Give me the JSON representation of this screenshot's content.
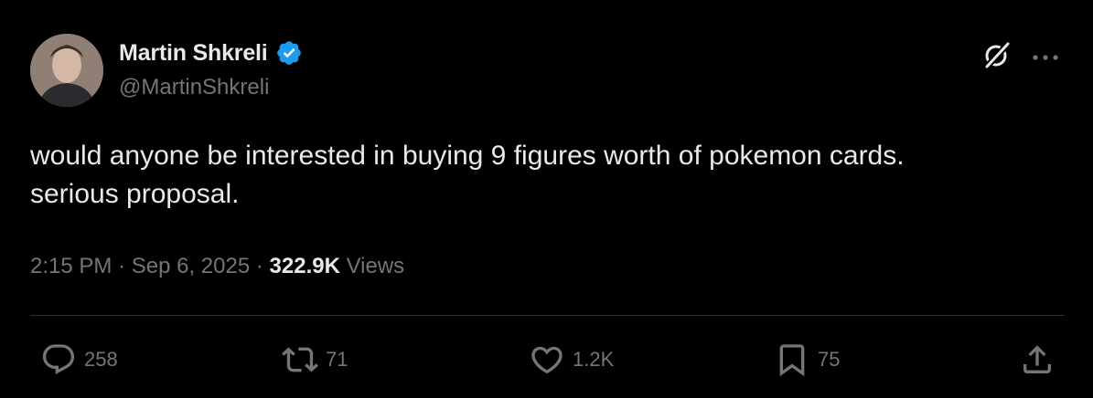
{
  "author": {
    "display_name": "Martin Shkreli",
    "handle": "@MartinShkreli",
    "verified": true
  },
  "tweet": {
    "text_lines": [
      "would anyone be interested in buying 9 figures worth of pokemon cards.",
      "serious proposal."
    ],
    "time": "2:15 PM",
    "date": "Sep 6, 2025",
    "separator": "·",
    "views_count": "322.9K",
    "views_label": "Views"
  },
  "actions": {
    "replies": "258",
    "reposts": "71",
    "likes": "1.2K",
    "bookmarks": "75"
  },
  "icons": [
    "grok-icon",
    "more-icon",
    "verified-badge-icon",
    "reply-icon",
    "repost-icon",
    "like-icon",
    "bookmark-icon",
    "share-icon"
  ],
  "colors": {
    "background": "#000000",
    "primary_text": "#e7e9ea",
    "secondary_text": "#71767b",
    "verified_blue": "#1d9bf0",
    "divider": "#2f3336"
  }
}
